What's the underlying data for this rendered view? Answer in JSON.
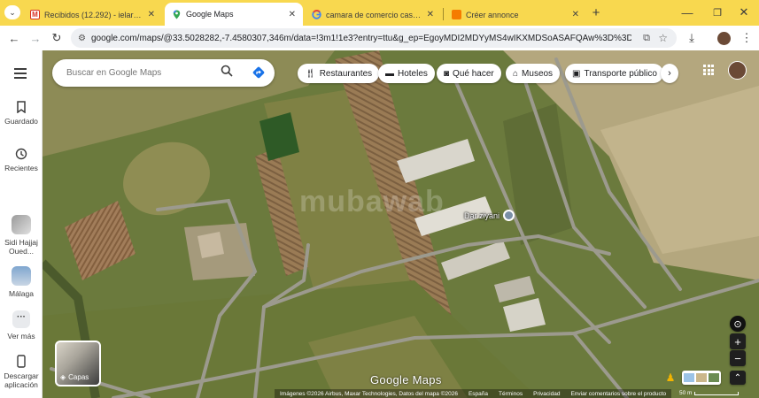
{
  "tabs": [
    {
      "title": "Recibidos (12.292) - ielarkam@",
      "favicon": "gmail-icon",
      "active": false
    },
    {
      "title": "Google Maps",
      "favicon": "maps-icon",
      "active": true
    },
    {
      "title": "camara de comercio casablanc",
      "favicon": "google-icon",
      "active": false
    },
    {
      "title": "Créer annonce",
      "favicon": "annonce-icon",
      "active": false
    }
  ],
  "address": {
    "url": "google.com/maps/@33.5028282,-7.4580307,346m/data=!3m1!1e3?entry=ttu&g_ep=EgoyMDI2MDYyMS4wIKXMDSoASAFQAw%3D%3D"
  },
  "rail": {
    "saved": "Guardado",
    "recent": "Recientes",
    "place1": "Sidi Hajjaj Oued...",
    "place2": "Málaga",
    "more": "Ver más",
    "download": "Descargar aplicación"
  },
  "search": {
    "placeholder": "Buscar en Google Maps"
  },
  "chips": [
    "Restaurantes",
    "Hoteles",
    "Qué hacer",
    "Museos",
    "Transporte público"
  ],
  "map": {
    "place_label": "Dar ziyani",
    "brand": "Google Maps",
    "watermark": "mubawab"
  },
  "layers": {
    "label": "Capas"
  },
  "footer": {
    "attribution": "Imágenes ©2026 Airbus, Maxar Technologies, Datos del mapa ©2026",
    "country": "España",
    "terms": "Términos",
    "privacy": "Privacidad",
    "feedback": "Enviar comentarios sobre el producto",
    "scale": "50 m"
  },
  "colors": {
    "accent": "#1a73e8",
    "tabbar": "#f8d84f"
  }
}
